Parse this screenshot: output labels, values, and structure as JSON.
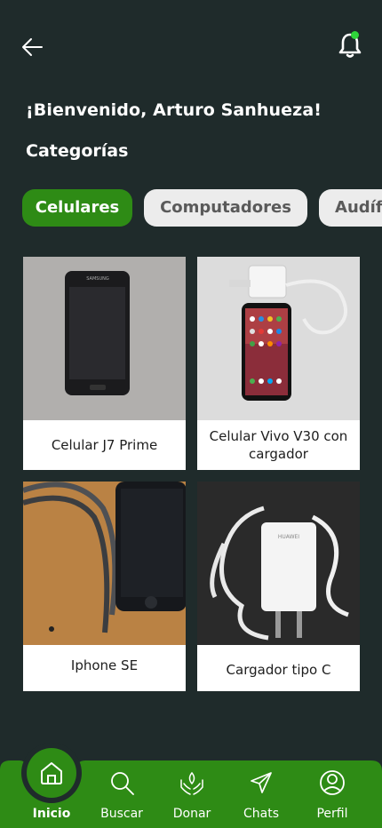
{
  "header": {
    "back_icon": "arrow-left-icon",
    "bell_icon": "bell-icon",
    "notification_color": "#2fd53a"
  },
  "welcome": "¡Bienvenido, Arturo Sanhueza!",
  "categories_title": "Categorías",
  "categories": [
    {
      "label": "Celulares",
      "active": true
    },
    {
      "label": "Computadores",
      "active": false
    },
    {
      "label": "Audífonos",
      "active": false
    }
  ],
  "products": [
    {
      "title": "Celular J7 Prime"
    },
    {
      "title": "Celular Vivo V30 con cargador"
    },
    {
      "title": "Iphone SE"
    },
    {
      "title": "Cargador tipo C"
    }
  ],
  "nav": {
    "items": [
      {
        "label": "Inicio",
        "icon": "home-icon",
        "active": true
      },
      {
        "label": "Buscar",
        "icon": "search-icon"
      },
      {
        "label": "Donar",
        "icon": "donate-hands-icon"
      },
      {
        "label": "Chats",
        "icon": "send-icon"
      },
      {
        "label": "Perfil",
        "icon": "profile-icon"
      }
    ]
  },
  "colors": {
    "background": "#1f2b2b",
    "accent": "#2e8b15",
    "chip_inactive": "#ececec"
  }
}
